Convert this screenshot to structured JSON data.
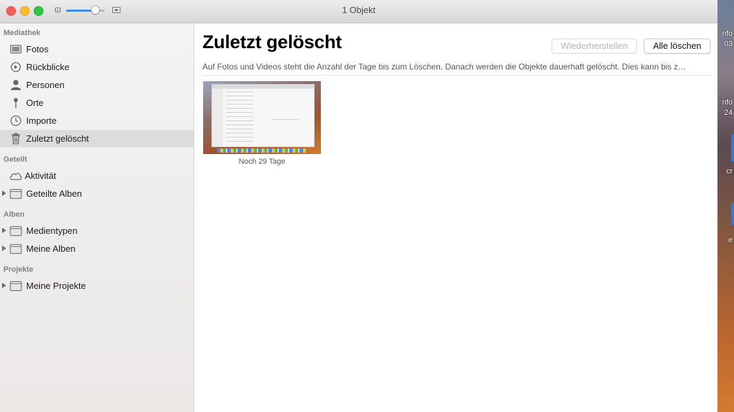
{
  "window": {
    "title": "1 Objekt"
  },
  "toolbar": {
    "zoom_level": 0.75
  },
  "sidebar": {
    "sections": [
      {
        "heading": "Mediathek",
        "items": [
          {
            "label": "Fotos",
            "icon": "photos-icon"
          },
          {
            "label": "Rückblicke",
            "icon": "memories-icon"
          },
          {
            "label": "Personen",
            "icon": "people-icon"
          },
          {
            "label": "Orte",
            "icon": "places-pin-icon"
          },
          {
            "label": "Importe",
            "icon": "clock-icon"
          },
          {
            "label": "Zuletzt gelöscht",
            "icon": "trash-icon",
            "selected": true
          }
        ]
      },
      {
        "heading": "Geteilt",
        "items": [
          {
            "label": "Aktivität",
            "icon": "cloud-icon"
          },
          {
            "label": "Geteilte Alben",
            "icon": "folder-icon"
          }
        ]
      },
      {
        "heading": "Alben",
        "items": [
          {
            "label": "Medientypen",
            "icon": "folder-icon"
          },
          {
            "label": "Meine Alben",
            "icon": "folder-icon"
          }
        ]
      },
      {
        "heading": "Projekte",
        "items": [
          {
            "label": "Meine Projekte",
            "icon": "folder-icon"
          }
        ]
      }
    ]
  },
  "main": {
    "title": "Zuletzt gelöscht",
    "restore_label": "Wiederherstellen",
    "delete_all_label": "Alle löschen",
    "info": "Auf Fotos und Videos steht die Anzahl der Tage bis zum Löschen. Danach werden die Objekte dauerhaft gelöscht. Dies kann bis z…",
    "items": [
      {
        "caption": "Noch 29 Tage"
      }
    ]
  },
  "desktop": {
    "fragments": [
      "nfo",
      "03",
      "nfo",
      "24",
      "cr",
      "e"
    ]
  },
  "colors": {
    "accent": "#3d8ef0",
    "selection": "#dcdcdc"
  }
}
